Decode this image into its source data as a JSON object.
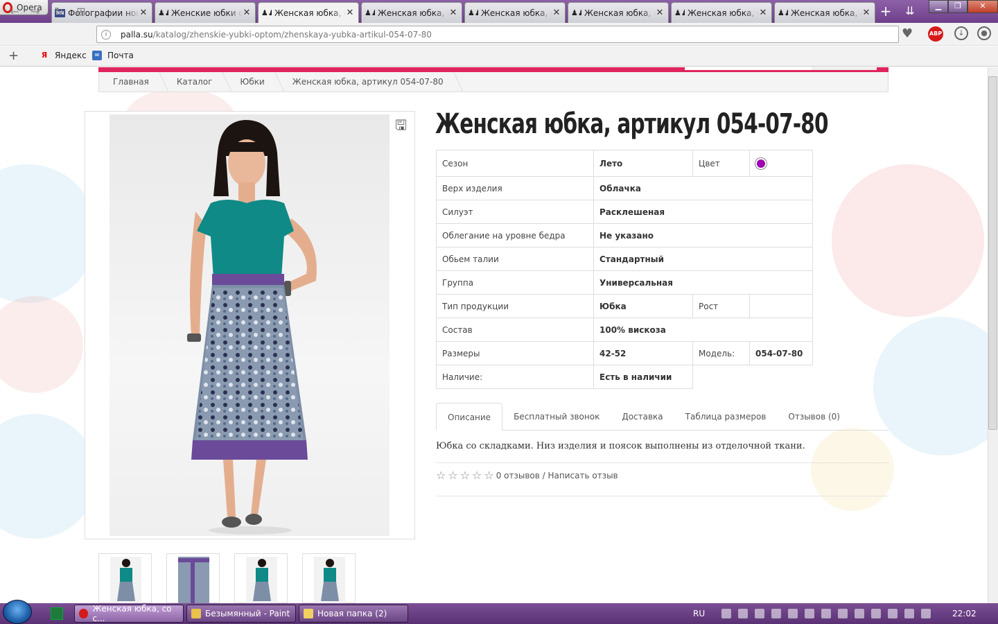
{
  "browser": {
    "menu_label": "Opera",
    "tabs": [
      {
        "icon": "nn-icon",
        "title": "Фотографии новостей",
        "active": false
      },
      {
        "icon": "dresses-icon",
        "title": "Женские юбки оптом",
        "active": false
      },
      {
        "icon": "dresses-icon",
        "title": "Женская юбка, со складками",
        "active": true
      },
      {
        "icon": "dresses-icon",
        "title": "Женская юбка, со складками",
        "active": false
      },
      {
        "icon": "dresses-icon",
        "title": "Женская юбка, со складками",
        "active": false
      },
      {
        "icon": "dresses-icon",
        "title": "Женская юбка, со складками",
        "active": false
      },
      {
        "icon": "dresses-icon",
        "title": "Женская юбка, со складками",
        "active": false
      },
      {
        "icon": "dresses-icon",
        "title": "Женская юбка, со складками",
        "active": false
      }
    ],
    "address": {
      "host": "palla.su",
      "path": "/katalog/zhenskie-yubki-optom/zhenskaya-yubka-artikul-054-07-80"
    },
    "abp_label": "ABP",
    "bookmarks": [
      {
        "icon": "yandex-icon",
        "label": "Яндекс"
      },
      {
        "icon": "mail-icon",
        "label": "Почта"
      }
    ]
  },
  "page": {
    "breadcrumbs": [
      "Главная",
      "Каталог",
      "Юбки",
      "Женская юбка, артикул 054-07-80"
    ],
    "product_title": "Женская юбка, артикул 054-07-80",
    "specs": {
      "season_label": "Сезон",
      "season_value": "Лето",
      "color_label": "Цвет",
      "color_hex": "#a000b0",
      "top_label": "Верх изделия",
      "top_value": "Облачка",
      "silhouette_label": "Силуэт",
      "silhouette_value": "Расклешеная",
      "hip_label": "Облегание на уровне бедра",
      "hip_value": "Не указано",
      "waist_label": "Обьем талии",
      "waist_value": "Стандартный",
      "group_label": "Группа",
      "group_value": "Универсальная",
      "type_label": "Тип продукции",
      "type_value": "Юбка",
      "height_label": "Рост",
      "height_value": "",
      "composition_label": "Состав",
      "composition_value": "100% вискоза",
      "sizes_label": "Размеры",
      "sizes_value": "42-52",
      "model_label": "Модель:",
      "model_value": "054-07-80",
      "availability_label": "Наличие:",
      "availability_value": "Есть в наличии"
    },
    "tabs": [
      "Описание",
      "Бесплатный звонок",
      "Доставка",
      "Таблица размеров",
      "Отзывов (0)"
    ],
    "description": "Юбка со складками. Низ изделия и поясок выполнены из отделочной ткани.",
    "rating": {
      "stars": 5,
      "filled": 0,
      "text": "0 отзывов / Написать отзыв"
    },
    "thumbnail_count": 4
  },
  "taskbar": {
    "buttons": [
      {
        "label": "Женская юбка, со с...",
        "active": true
      },
      {
        "label": "Безымянный - Paint",
        "active": false
      },
      {
        "label": "Новая папка (2)",
        "active": false
      }
    ],
    "lang": "RU",
    "clock": "22:02"
  },
  "colors": {
    "accent": "#e0245e",
    "tabbar": "#7a4e94",
    "teal_top": "#0f8a86",
    "skirt_band": "#6b4a9a"
  }
}
